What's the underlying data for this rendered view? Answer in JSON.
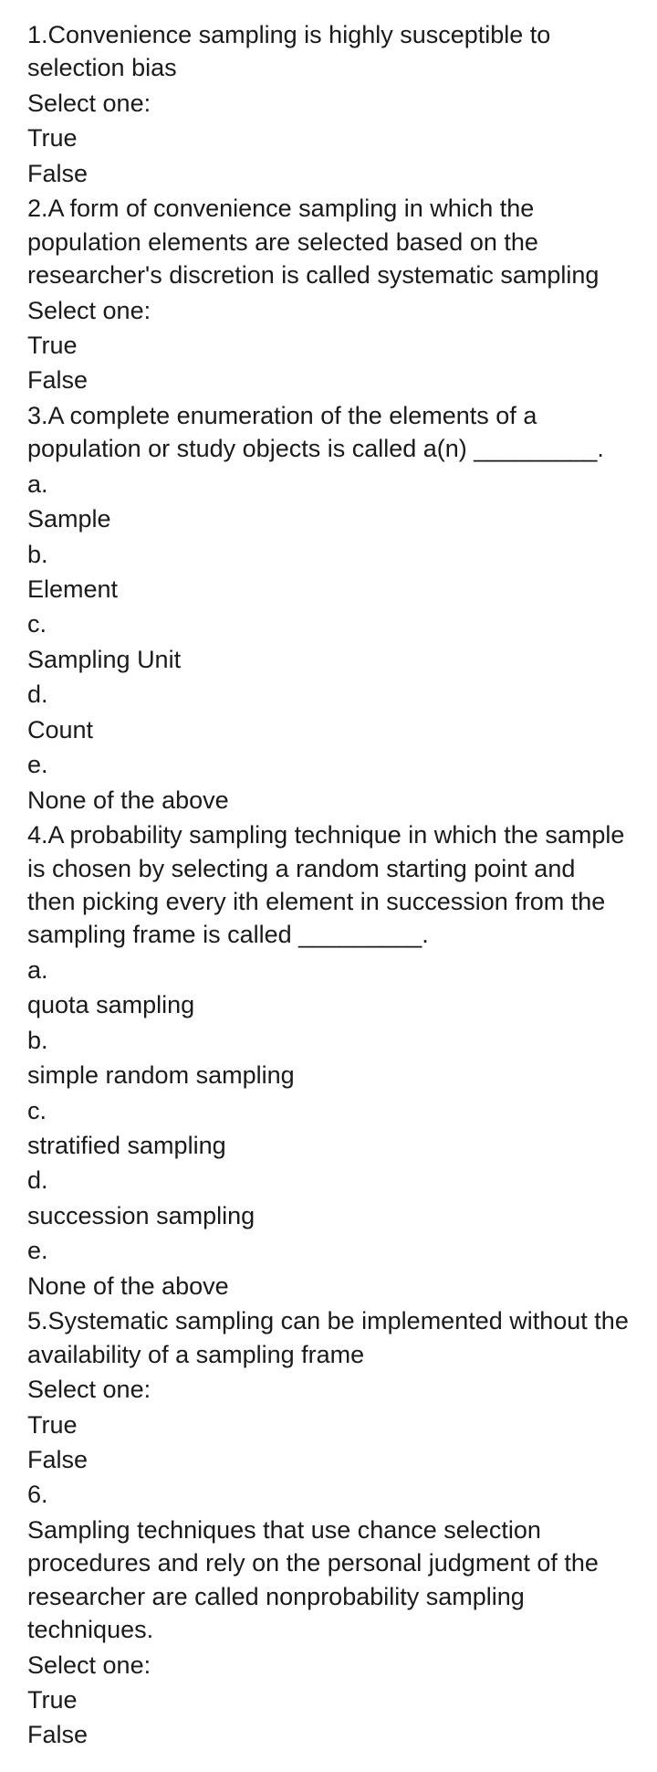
{
  "questions": [
    {
      "number": "1.",
      "text": "Convenience sampling is highly susceptible to selection bias",
      "prompt": "Select one:",
      "options": [
        "True",
        "False"
      ]
    },
    {
      "number": "2.",
      "text": "A form of convenience sampling in which the population elements are selected based on the researcher's discretion is called systematic sampling",
      "prompt": "Select one:",
      "options": [
        "True",
        "False"
      ]
    },
    {
      "number": "3.",
      "text": "A complete enumeration of the elements of a population or study objects is called a(n) _________.",
      "prompt": "",
      "letteredOptions": [
        {
          "letter": "a.",
          "text": "Sample"
        },
        {
          "letter": "b.",
          "text": "Element"
        },
        {
          "letter": "c.",
          "text": "Sampling Unit"
        },
        {
          "letter": "d.",
          "text": "Count"
        },
        {
          "letter": "e.",
          "text": "None of the above"
        }
      ]
    },
    {
      "number": "4.",
      "text": "A probability sampling technique in which the sample is chosen by selecting a random starting point and then picking every ith element in succession from the sampling frame is called _________.",
      "prompt": "",
      "letteredOptions": [
        {
          "letter": "a.",
          "text": "quota sampling"
        },
        {
          "letter": "b.",
          "text": "simple random sampling"
        },
        {
          "letter": "c.",
          "text": "stratified sampling"
        },
        {
          "letter": "d.",
          "text": "succession sampling"
        },
        {
          "letter": "e.",
          "text": "None of the above"
        }
      ]
    },
    {
      "number": "5.",
      "text": "Systematic sampling can be implemented without the availability of a sampling frame",
      "prompt": "Select one:",
      "options": [
        "True",
        "False"
      ]
    },
    {
      "number": "6.",
      "text": "Sampling techniques that use chance selection procedures and rely on the personal judgment of the researcher are called nonprobability sampling techniques.",
      "prompt": "Select one:",
      "options": [
        "True",
        "False"
      ],
      "numberSeparate": true
    }
  ]
}
